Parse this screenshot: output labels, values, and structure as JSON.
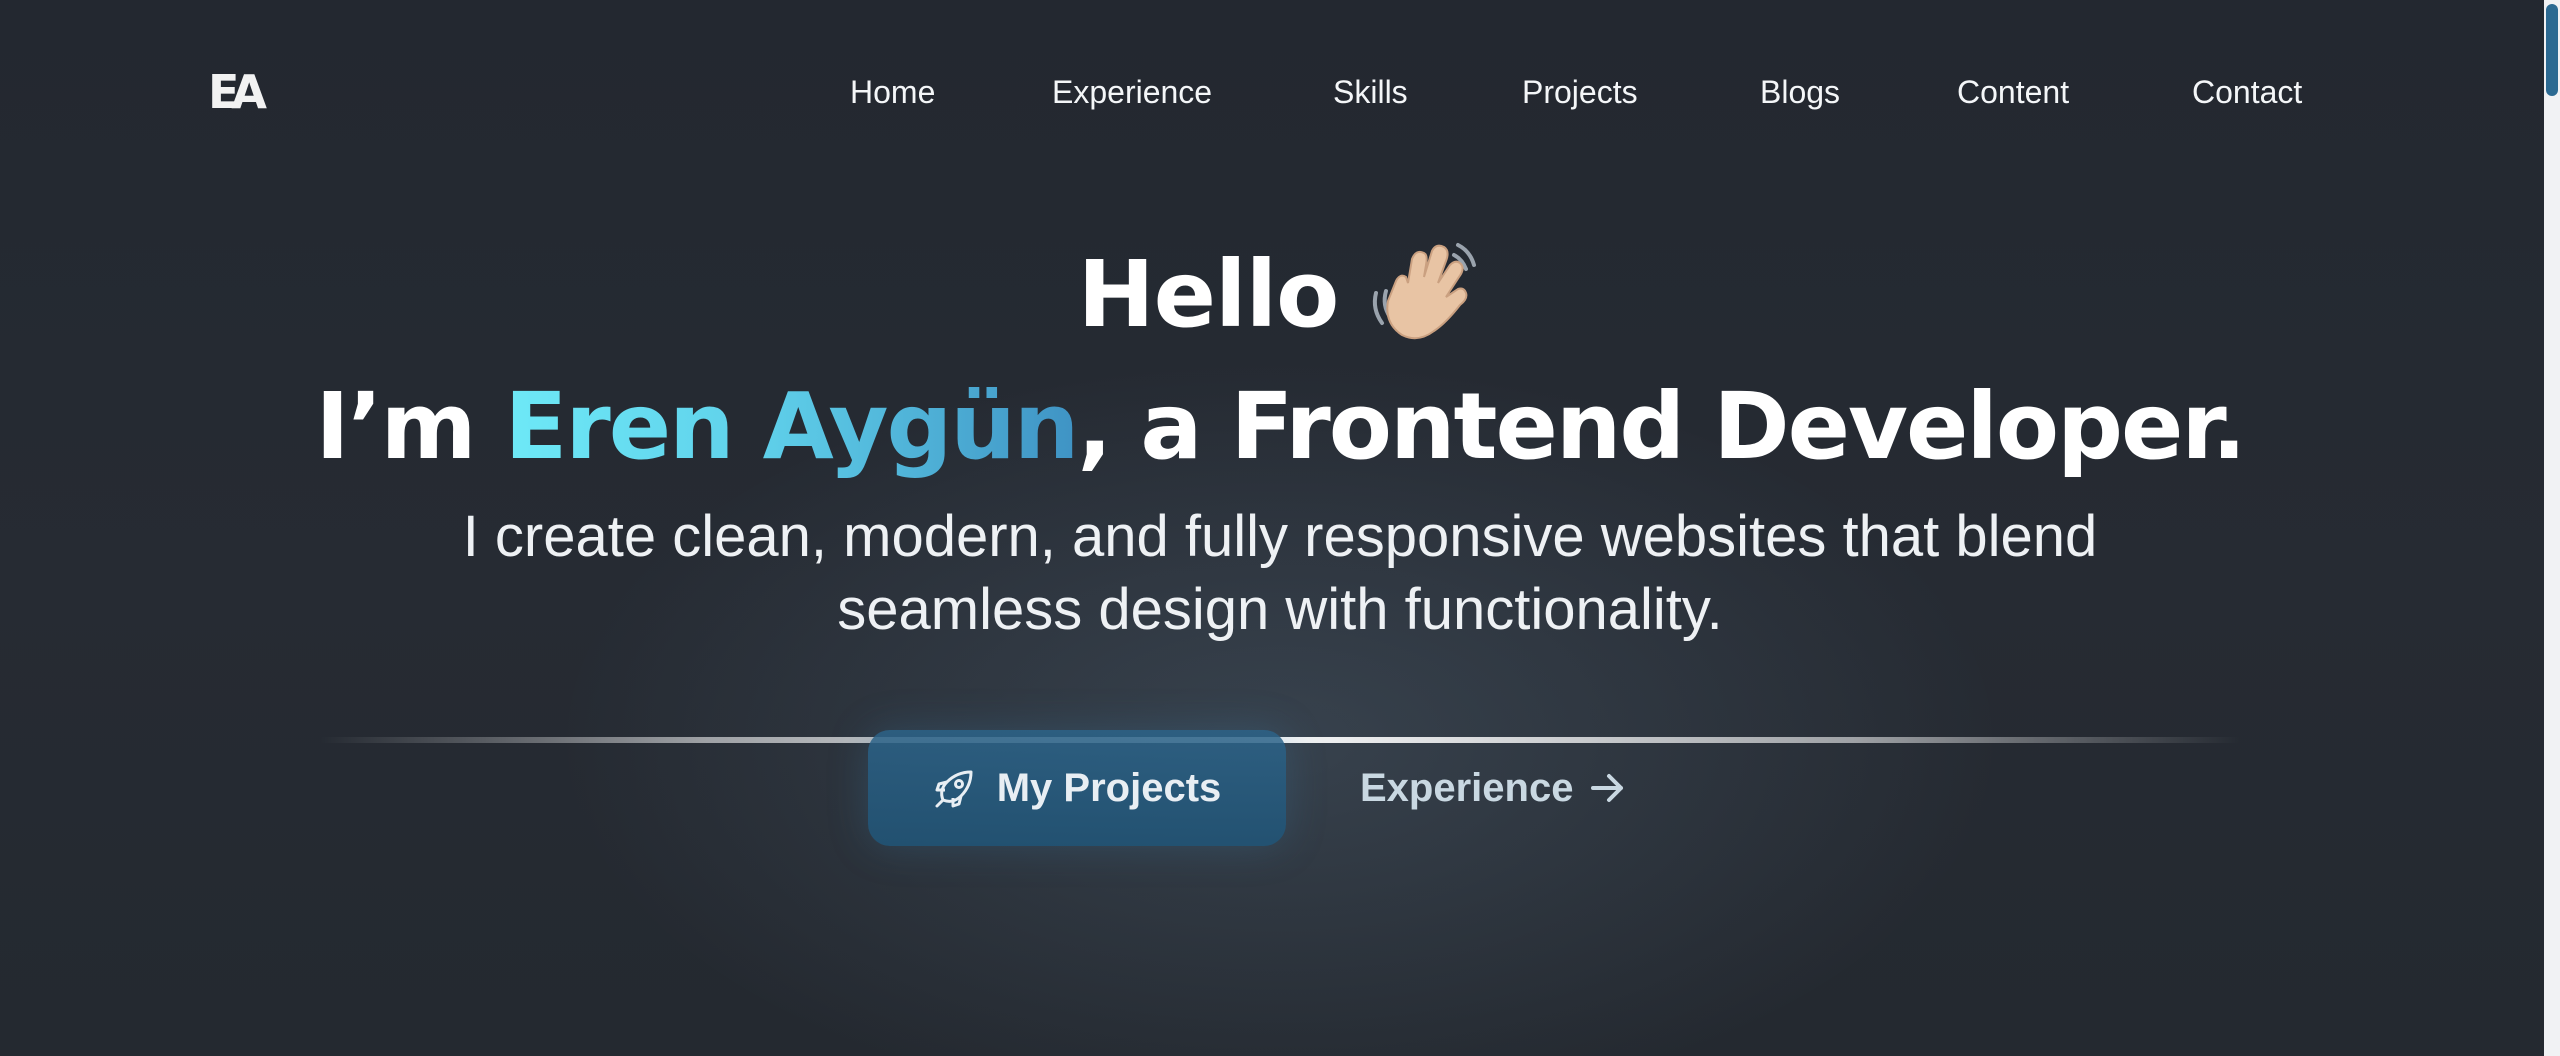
{
  "header": {
    "logo_text": "EA",
    "nav": [
      "Home",
      "Experience",
      "Skills",
      "Projects",
      "Blogs",
      "Content",
      "Contact"
    ]
  },
  "hero": {
    "hello": "Hello",
    "wave_icon": "waving-hand-icon",
    "intro_prefix": "I’m ",
    "name": "Eren Aygün",
    "intro_suffix": ", a Frontend Developer.",
    "tagline_line1": "I create clean, modern, and fully responsive websites that blend",
    "tagline_line2": "seamless design with functionality."
  },
  "actions": {
    "projects_label": "My Projects",
    "projects_icon": "rocket-icon",
    "experience_label": "Experience",
    "experience_icon": "arrow-right-icon"
  },
  "colors": {
    "background": "#262b33",
    "accent_start": "#6ee9f7",
    "accent_end": "#3f93c4",
    "primary_button": "#2a5f84",
    "scrollbar_thumb": "#2c6a92"
  }
}
